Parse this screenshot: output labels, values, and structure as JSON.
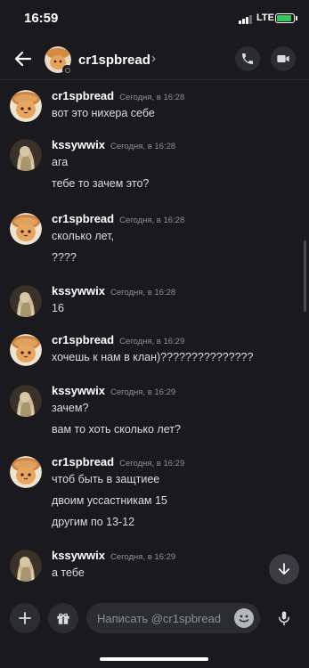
{
  "status_bar": {
    "time": "16:59",
    "network": "LTE",
    "battery_level": 0.9,
    "battery_charging": true
  },
  "header": {
    "name": "cr1spbread",
    "chevron": "›"
  },
  "messages": [
    {
      "author": "cr1spbread",
      "avatar": "bread-cat-avatar",
      "timestamp": "Сегодня, в 16:28",
      "lines": [
        "вот это нихера себе"
      ]
    },
    {
      "author": "kssywwix",
      "avatar": "blonde-girl-avatar",
      "timestamp": "Сегодня, в 16:28",
      "lines": [
        "ага",
        "тебе то зачем это?"
      ]
    },
    {
      "author": "cr1spbread",
      "avatar": "bread-cat-avatar",
      "timestamp": "Сегодня, в 16:28",
      "lines": [
        "сколько лет,",
        "????"
      ]
    },
    {
      "author": "kssywwix",
      "avatar": "blonde-girl-avatar",
      "timestamp": "Сегодня, в 16:28",
      "lines": [
        "16"
      ]
    },
    {
      "author": "cr1spbread",
      "avatar": "bread-cat-avatar",
      "timestamp": "Сегодня, в 16:29",
      "lines": [
        "хочешь к нам в клан)???????????????"
      ]
    },
    {
      "author": "kssywwix",
      "avatar": "blonde-girl-avatar",
      "timestamp": "Сегодня, в 16:29",
      "lines": [
        "зачем?",
        "вам то хоть сколько лет?"
      ]
    },
    {
      "author": "cr1spbread",
      "avatar": "bread-cat-avatar",
      "timestamp": "Сегодня, в 16:29",
      "lines": [
        "чтоб быть в защтиее",
        "двоим уссастникам 15",
        "другим по 13-12"
      ]
    },
    {
      "author": "kssywwix",
      "avatar": "blonde-girl-avatar",
      "timestamp": "Сегодня, в 16:29",
      "lines": [
        "а тебе"
      ]
    }
  ],
  "composer": {
    "placeholder": "Написать @cr1spbread"
  },
  "colors": {
    "background": "#1a1a1e",
    "surface": "#2b2d31",
    "text": "#dcdde1",
    "muted": "#8e9097"
  }
}
